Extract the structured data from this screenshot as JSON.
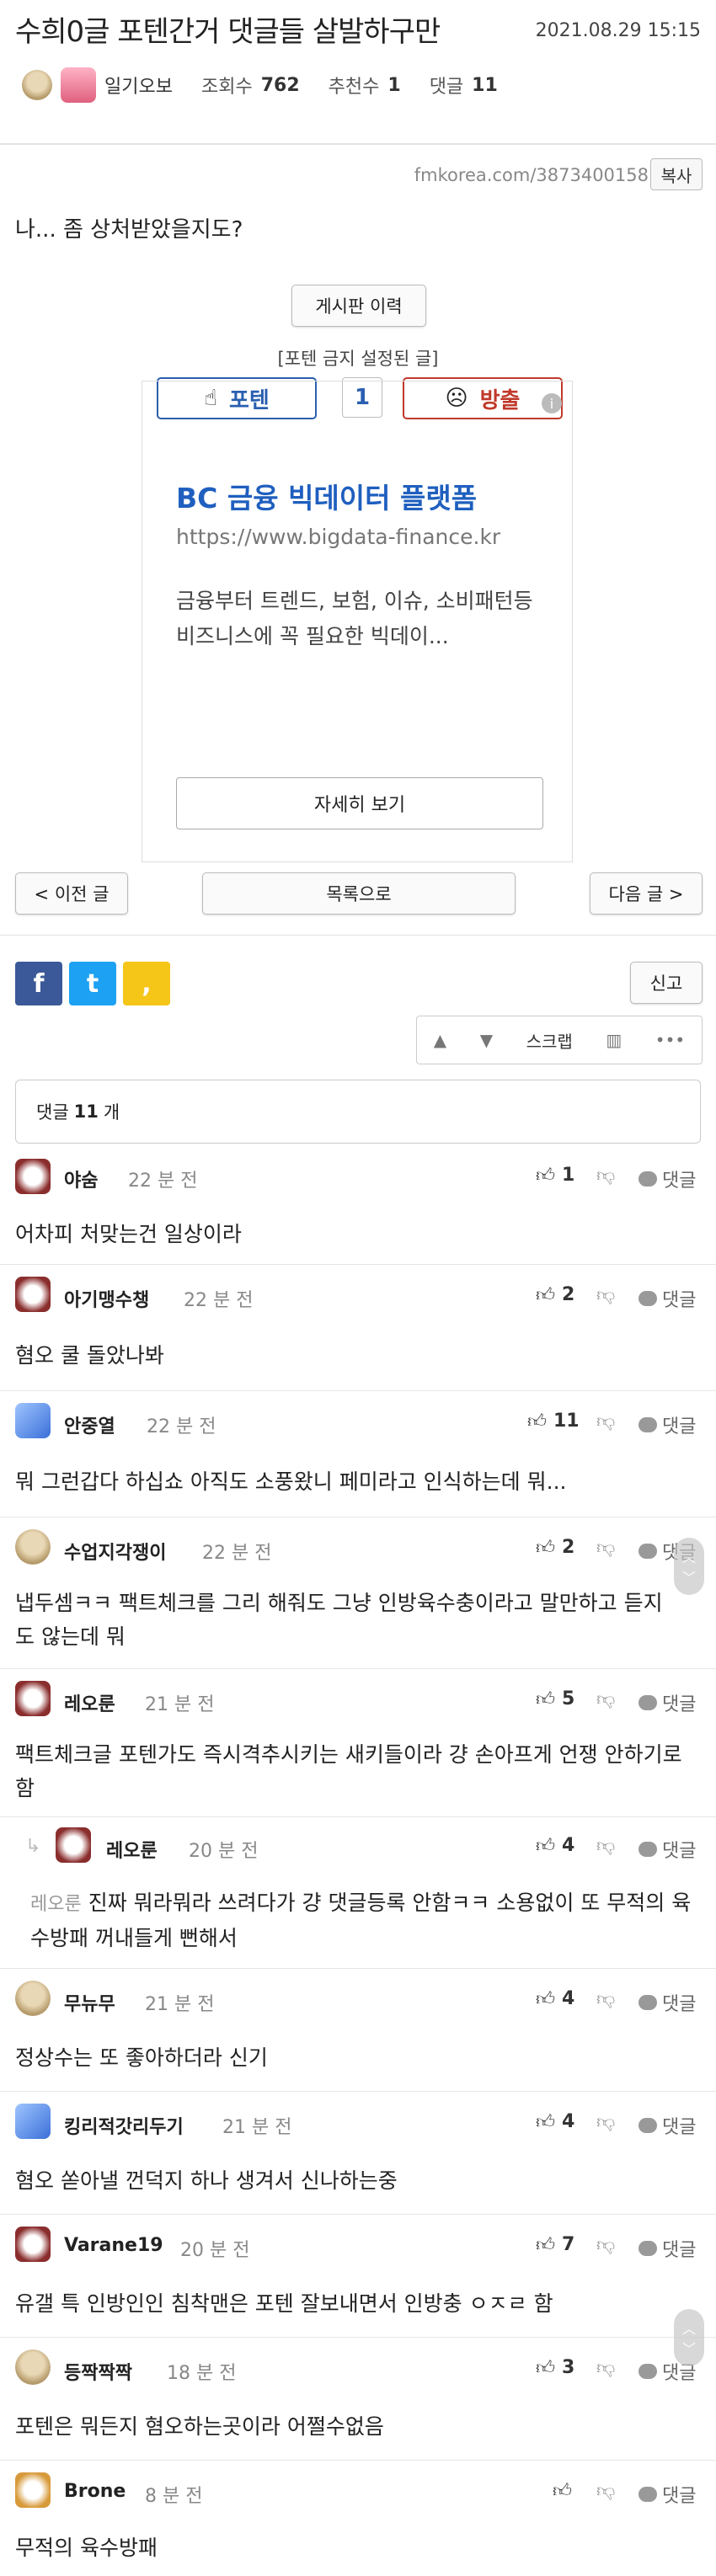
{
  "header": {
    "title": "수희0글 포텐간거 댓글들 살발하구만",
    "date": "2021.08.29 15:15"
  },
  "meta": {
    "author": "일기오보",
    "views_label": "조회수",
    "views": "762",
    "recommend_label": "추천수",
    "recommend": "1",
    "comments_label": "댓글",
    "comments": "11"
  },
  "url_bar": {
    "url": "fmkorea.com/3873400158",
    "copy_label": "복사"
  },
  "post": {
    "body": "나... 좀 상처받았을지도?"
  },
  "history_button": "게시판 이력",
  "poten_notice": "[포텐 금지 설정된 글]",
  "vote": {
    "up_label": "포텐",
    "count": "1",
    "down_label": "방출"
  },
  "ad": {
    "title": "BC 금융 빅데이터 플랫폼",
    "url": "https://www.bigdata-finance.kr",
    "description": "금융부터 트렌드, 보험, 이슈, 소비패턴등 비즈니스에 꼭 필요한 빅데이...",
    "cta": "자세히 보기",
    "info": "i"
  },
  "nav": {
    "prev": "< 이전 글",
    "list": "목록으로",
    "next": "다음 글 >"
  },
  "share": {
    "facebook": "f",
    "twitter": "t",
    "kakao": ","
  },
  "report_label": "신고",
  "toolbar": {
    "scrap": "스크랩",
    "more": "•••"
  },
  "comment_count": {
    "label": "댓글",
    "count": "11",
    "unit": "개"
  },
  "comments": [
    {
      "name": "야숨",
      "time": "22 분 전",
      "votes": "1",
      "reply": "댓글",
      "text": "어차피 처맞는건 일상이라"
    },
    {
      "name": "아기맹수챙",
      "time": "22 분 전",
      "votes": "2",
      "reply": "댓글",
      "text": "혐오 쿨 돌았나봐"
    },
    {
      "name": "안중열",
      "time": "22 분 전",
      "votes": "11",
      "reply": "댓글",
      "text": "뭐 그런갑다 하십쇼 아직도 소풍왔니 페미라고 인식하는데 뭐..."
    },
    {
      "name": "수업지각쟁이",
      "time": "22 분 전",
      "votes": "2",
      "reply": "댓글",
      "text": "냅두셈ㅋㅋ 팩트체크를 그리 해줘도 그냥 인방육수충이라고 말만하고 듣지도 않는데 뭐"
    },
    {
      "name": "레오룬",
      "time": "21 분 전",
      "votes": "5",
      "reply": "댓글",
      "text": "팩트체크글 포텐가도 즉시격추시키는 새키들이라 걍 손아프게 언쟁 안하기로 함"
    },
    {
      "name": "레오룬",
      "time": "20 분 전",
      "votes": "4",
      "reply": "댓글",
      "mention": "레오룬",
      "text": "진짜 뭐라뭐라 쓰려다가 걍 댓글등록 안함ㅋㅋ 소용없이 또 무적의 육수방패 꺼내들게 뻔해서"
    },
    {
      "name": "무뉴무",
      "time": "21 분 전",
      "votes": "4",
      "reply": "댓글",
      "text": "정상수는 또 좋아하더라 신기"
    },
    {
      "name": "킹리적갓리두기",
      "time": "21 분 전",
      "votes": "4",
      "reply": "댓글",
      "text": "혐오 쏟아낼 껀덕지 하나 생겨서 신나하는중"
    },
    {
      "name": "Varane19",
      "time": "20 분 전",
      "votes": "7",
      "reply": "댓글",
      "text": "유갤 특 인방인인 침착맨은 포텐 잘보내면서 인방충 ㅇㅈㄹ 함"
    },
    {
      "name": "등짝짝짝",
      "time": "18 분 전",
      "votes": "3",
      "reply": "댓글",
      "text": "포텐은 뭐든지 혐오하는곳이라 어쩔수없음"
    },
    {
      "name": "Brone",
      "time": "8 분 전",
      "votes": "",
      "reply": "댓글",
      "text": "무적의 육수방패"
    }
  ],
  "colors": {
    "accent_blue": "#1f5fbf",
    "vote_down_red": "#c0392b",
    "facebook": "#3b5998",
    "twitter": "#1da1f2",
    "kakao": "#f5c518"
  }
}
